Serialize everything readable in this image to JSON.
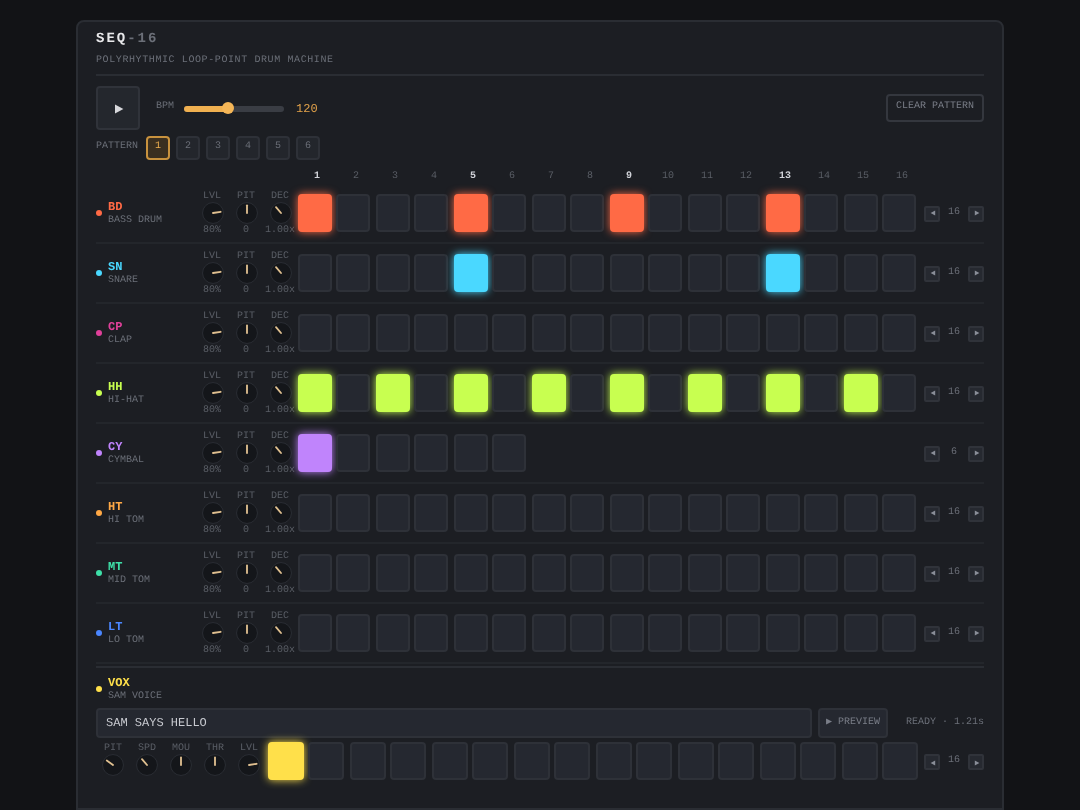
{
  "header": {
    "title": "SEQ",
    "title_suffix": "-16",
    "subtitle": "POLYRHYTHMIC LOOP-POINT DRUM MACHINE"
  },
  "transport": {
    "bpm_label": "BPM",
    "bpm": {
      "level": 0.44
    },
    "bpm_value": "120",
    "clear": "CLEAR PATTERN"
  },
  "patterns": {
    "label": "PATTERN",
    "items": [
      {
        "label": "1",
        "selected": true
      },
      {
        "label": "2",
        "selected": false
      },
      {
        "label": "3",
        "selected": false
      },
      {
        "label": "4",
        "selected": false
      },
      {
        "label": "5",
        "selected": false
      },
      {
        "label": "6",
        "selected": false
      }
    ]
  },
  "step_numbers": [
    {
      "label": "1",
      "accent": true
    },
    {
      "label": "2",
      "accent": false
    },
    {
      "label": "3",
      "accent": false
    },
    {
      "label": "4",
      "accent": false
    },
    {
      "label": "5",
      "accent": true
    },
    {
      "label": "6",
      "accent": false
    },
    {
      "label": "7",
      "accent": false
    },
    {
      "label": "8",
      "accent": false
    },
    {
      "label": "9",
      "accent": true
    },
    {
      "label": "10",
      "accent": false
    },
    {
      "label": "11",
      "accent": false
    },
    {
      "label": "12",
      "accent": false
    },
    {
      "label": "13",
      "accent": true
    },
    {
      "label": "14",
      "accent": false
    },
    {
      "label": "15",
      "accent": false
    },
    {
      "label": "16",
      "accent": false
    }
  ],
  "tracks": [
    {
      "code": "BD",
      "name": "BASS DRUM",
      "color": "#ff6a45",
      "knobs": [
        {
          "label": "LVL",
          "value": "80%"
        },
        {
          "label": "PIT",
          "value": "0"
        },
        {
          "label": "DEC",
          "value": "1.00x"
        }
      ],
      "steps": [
        true,
        false,
        false,
        false,
        true,
        false,
        false,
        false,
        true,
        false,
        false,
        false,
        true,
        false,
        false,
        false
      ],
      "length": "16"
    },
    {
      "code": "SN",
      "name": "SNARE",
      "color": "#4ad8ff",
      "knobs": [
        {
          "label": "LVL",
          "value": "80%"
        },
        {
          "label": "PIT",
          "value": "0"
        },
        {
          "label": "DEC",
          "value": "1.00x"
        }
      ],
      "steps": [
        false,
        false,
        false,
        false,
        true,
        false,
        false,
        false,
        false,
        false,
        false,
        false,
        true,
        false,
        false,
        false
      ],
      "length": "16"
    },
    {
      "code": "CP",
      "name": "CLAP",
      "color": "#e0409a",
      "knobs": [
        {
          "label": "LVL",
          "value": "80%"
        },
        {
          "label": "PIT",
          "value": "0"
        },
        {
          "label": "DEC",
          "value": "1.00x"
        }
      ],
      "steps": [
        false,
        false,
        false,
        false,
        false,
        false,
        false,
        false,
        false,
        false,
        false,
        false,
        false,
        false,
        false,
        false
      ],
      "length": "16"
    },
    {
      "code": "HH",
      "name": "HI-HAT",
      "color": "#c8ff50",
      "knobs": [
        {
          "label": "LVL",
          "value": "80%"
        },
        {
          "label": "PIT",
          "value": "0"
        },
        {
          "label": "DEC",
          "value": "1.00x"
        }
      ],
      "steps": [
        true,
        false,
        true,
        false,
        true,
        false,
        true,
        false,
        true,
        false,
        true,
        false,
        true,
        false,
        true,
        false
      ],
      "length": "16"
    },
    {
      "code": "CY",
      "name": "CYMBAL",
      "color": "#c084fc",
      "knobs": [
        {
          "label": "LVL",
          "value": "80%"
        },
        {
          "label": "PIT",
          "value": "0"
        },
        {
          "label": "DEC",
          "value": "1.00x"
        }
      ],
      "steps": [
        true,
        false,
        false,
        false,
        false,
        false
      ],
      "length": "6"
    },
    {
      "code": "HT",
      "name": "HI TOM",
      "color": "#ffa845",
      "knobs": [
        {
          "label": "LVL",
          "value": "80%"
        },
        {
          "label": "PIT",
          "value": "0"
        },
        {
          "label": "DEC",
          "value": "1.00x"
        }
      ],
      "steps": [
        false,
        false,
        false,
        false,
        false,
        false,
        false,
        false,
        false,
        false,
        false,
        false,
        false,
        false,
        false,
        false
      ],
      "length": "16"
    },
    {
      "code": "MT",
      "name": "MID TOM",
      "color": "#3ee0a8",
      "knobs": [
        {
          "label": "LVL",
          "value": "80%"
        },
        {
          "label": "PIT",
          "value": "0"
        },
        {
          "label": "DEC",
          "value": "1.00x"
        }
      ],
      "steps": [
        false,
        false,
        false,
        false,
        false,
        false,
        false,
        false,
        false,
        false,
        false,
        false,
        false,
        false,
        false,
        false
      ],
      "length": "16"
    },
    {
      "code": "LT",
      "name": "LO TOM",
      "color": "#4a86ff",
      "knobs": [
        {
          "label": "LVL",
          "value": "80%"
        },
        {
          "label": "PIT",
          "value": "0"
        },
        {
          "label": "DEC",
          "value": "1.00x"
        }
      ],
      "steps": [
        false,
        false,
        false,
        false,
        false,
        false,
        false,
        false,
        false,
        false,
        false,
        false,
        false,
        false,
        false,
        false
      ],
      "length": "16"
    }
  ],
  "vox": {
    "code": "VOX",
    "name": "SAM VOICE",
    "color": "#ffe04a",
    "text": "SAM SAYS HELLO",
    "preview": "▶ PREVIEW",
    "status": "READY · 1.21s",
    "knobs": [
      {
        "label": "PIT"
      },
      {
        "label": "SPD"
      },
      {
        "label": "MOU"
      },
      {
        "label": "THR"
      },
      {
        "label": "LVL"
      }
    ],
    "steps": [
      true,
      false,
      false,
      false,
      false,
      false,
      false,
      false,
      false,
      false,
      false,
      false,
      false,
      false,
      false,
      false
    ],
    "length": "16"
  }
}
